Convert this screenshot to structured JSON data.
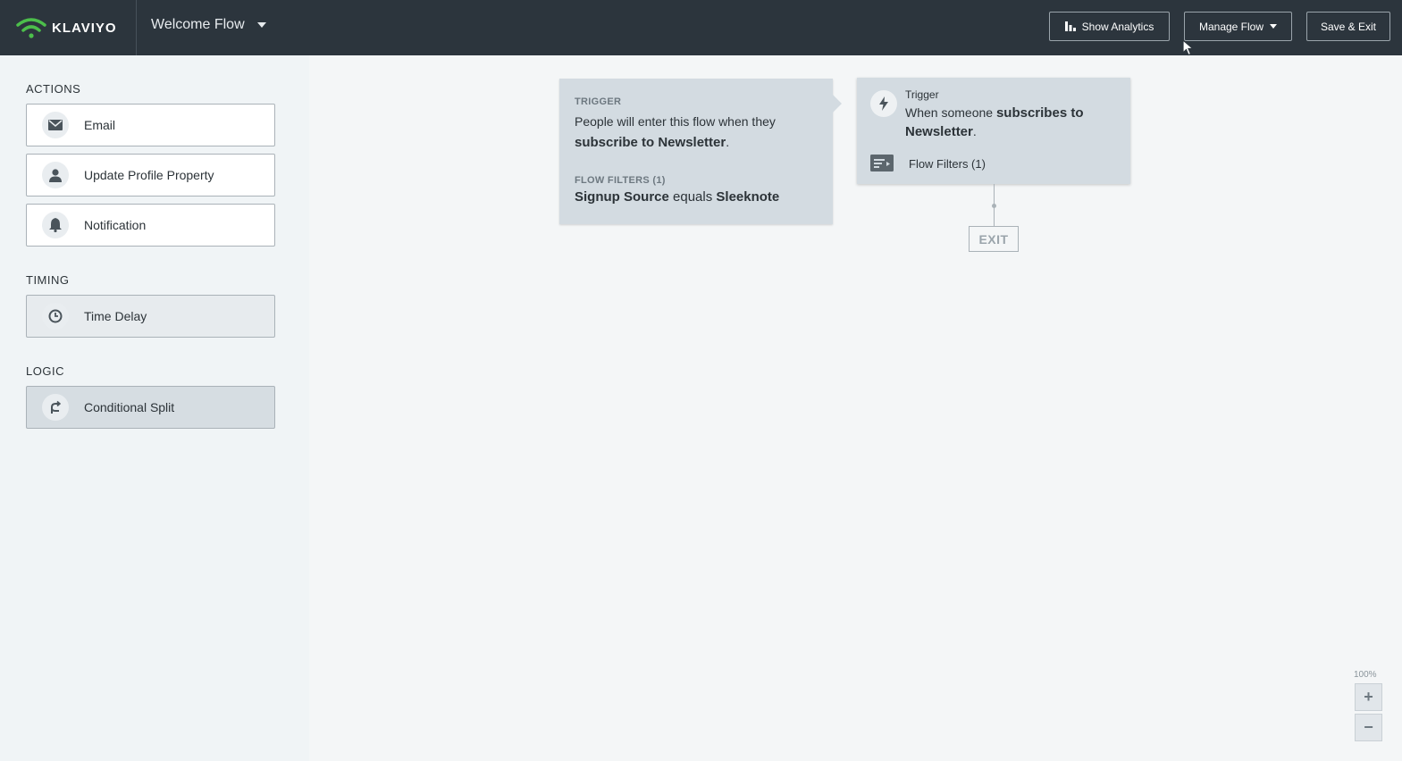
{
  "header": {
    "brand": "KLAVIYO",
    "flow_name": "Welcome Flow",
    "show_analytics_label": "Show Analytics",
    "manage_flow_label": "Manage Flow",
    "save_exit_label": "Save & Exit",
    "brand_color": "#4cbf4b",
    "bar_color": "#2c353d"
  },
  "sidebar": {
    "actions_title": "ACTIONS",
    "actions": [
      {
        "label": "Email",
        "icon": "envelope-icon"
      },
      {
        "label": "Update Profile Property",
        "icon": "person-icon"
      },
      {
        "label": "Notification",
        "icon": "bell-icon"
      }
    ],
    "timing_title": "TIMING",
    "timing": [
      {
        "label": "Time Delay",
        "icon": "clock-icon"
      }
    ],
    "logic_title": "LOGIC",
    "logic": [
      {
        "label": "Conditional Split",
        "icon": "split-icon"
      }
    ]
  },
  "trigger_panel": {
    "heading": "TRIGGER",
    "text_prefix": "People will enter this flow when they",
    "text_bold": "subscribe to Newsletter",
    "text_suffix": ".",
    "filters_heading": "FLOW FILTERS (1)",
    "filter_field": "Signup Source",
    "filter_operator": "equals",
    "filter_value": "Sleeknote"
  },
  "trigger_node": {
    "label": "Trigger",
    "text_prefix": "When someone",
    "text_bold": "subscribes to Newsletter",
    "text_suffix": ".",
    "filters_label": "Flow Filters (1)"
  },
  "exit_label": "EXIT",
  "zoom": {
    "level": "100%",
    "zoom_in": "+",
    "zoom_out": "−"
  }
}
